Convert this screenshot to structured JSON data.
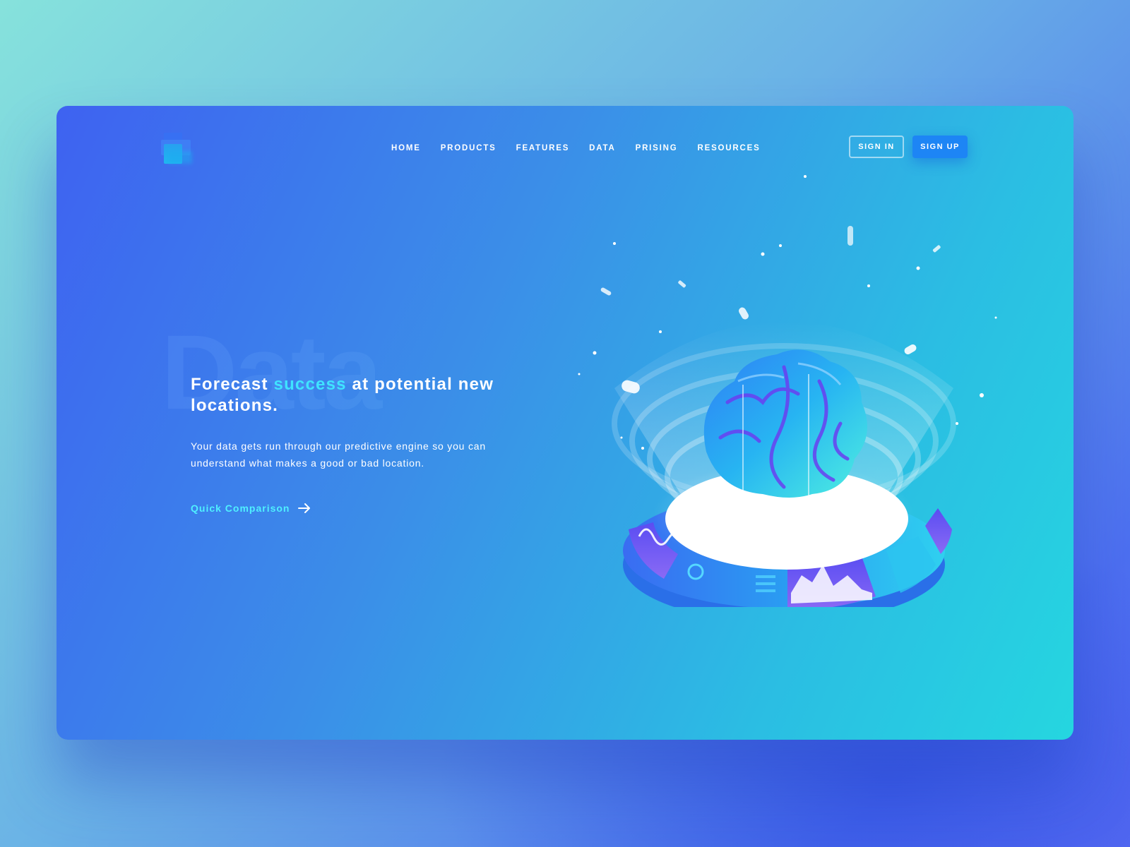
{
  "nav": {
    "items": [
      "HOME",
      "PRODUCTS",
      "FEATURES",
      "DATA",
      "PRISING",
      "RESOURCES"
    ]
  },
  "auth": {
    "signin_label": "SIGN IN",
    "signup_label": "SIGN UP"
  },
  "hero": {
    "background_word": "Data",
    "headline_pre": "Forecast ",
    "headline_highlight": "success",
    "headline_post": " at potential new locations.",
    "subtext": "Your data gets run through our predictive engine so you can understand what makes a good or bad location.",
    "cta_label": "Quick Comparison"
  },
  "colors": {
    "accent": "#3fe3ff",
    "button_primary": "#1d85f5",
    "card_start": "#3e62f1",
    "card_end": "#25d6e0"
  },
  "icons": {
    "logo": "brand-logo-icon",
    "cta_arrow": "arrow-right-icon",
    "illustration": "brain-hologram-illustration"
  }
}
